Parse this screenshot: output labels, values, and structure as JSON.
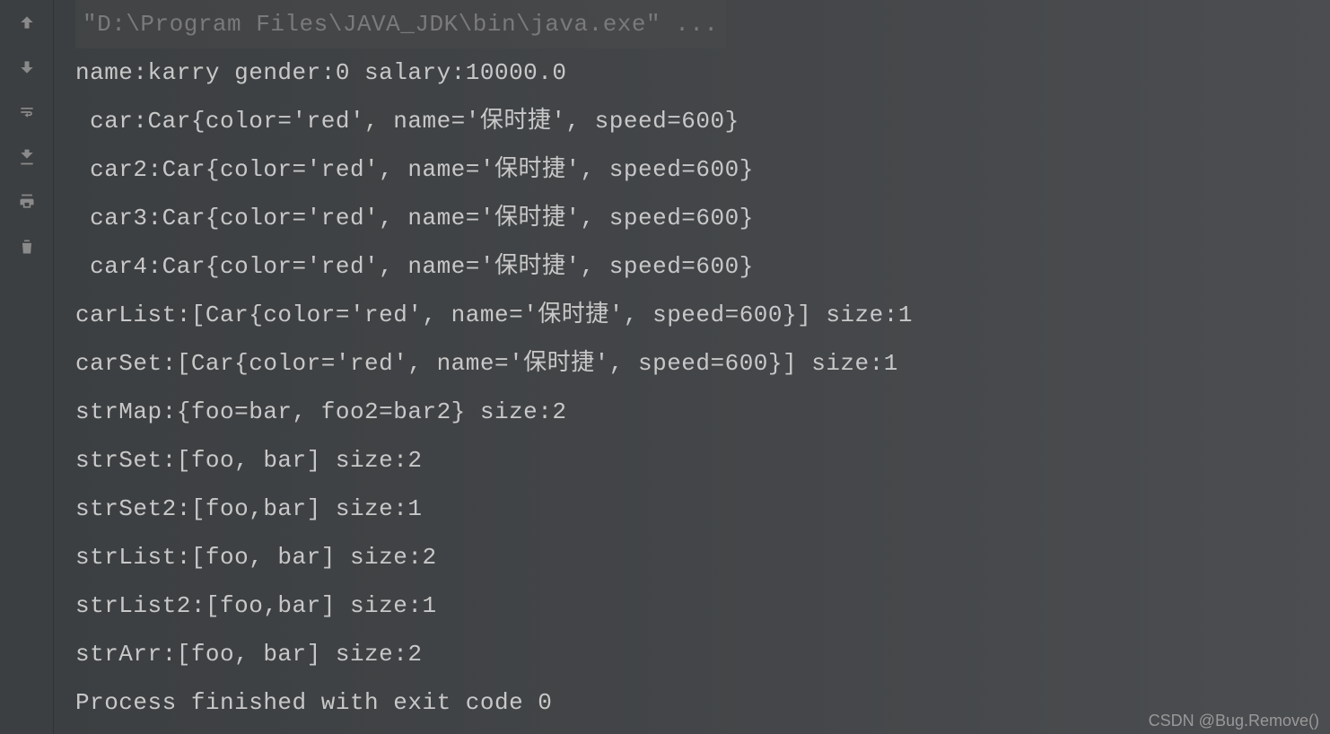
{
  "toolbar": {
    "icons": [
      {
        "name": "scroll-up-icon",
        "label": "up"
      },
      {
        "name": "scroll-down-icon",
        "label": "down"
      },
      {
        "name": "soft-wrap-icon",
        "label": "wrap"
      },
      {
        "name": "scroll-to-end-icon",
        "label": "end"
      },
      {
        "name": "print-icon",
        "label": "print"
      },
      {
        "name": "clear-icon",
        "label": "clear"
      }
    ]
  },
  "console": {
    "command": "\"D:\\Program Files\\JAVA_JDK\\bin\\java.exe\" ...",
    "lines": [
      "name:karry gender:0 salary:10000.0",
      " car:Car{color='red', name='保时捷', speed=600}",
      " car2:Car{color='red', name='保时捷', speed=600}",
      " car3:Car{color='red', name='保时捷', speed=600}",
      " car4:Car{color='red', name='保时捷', speed=600}",
      "carList:[Car{color='red', name='保时捷', speed=600}] size:1",
      "carSet:[Car{color='red', name='保时捷', speed=600}] size:1",
      "strMap:{foo=bar, foo2=bar2} size:2",
      "strSet:[foo, bar] size:2",
      "strSet2:[foo,bar] size:1",
      "strList:[foo, bar] size:2",
      "strList2:[foo,bar] size:1",
      "strArr:[foo, bar] size:2",
      "",
      "Process finished with exit code 0"
    ]
  },
  "watermark": "CSDN @Bug.Remove()"
}
